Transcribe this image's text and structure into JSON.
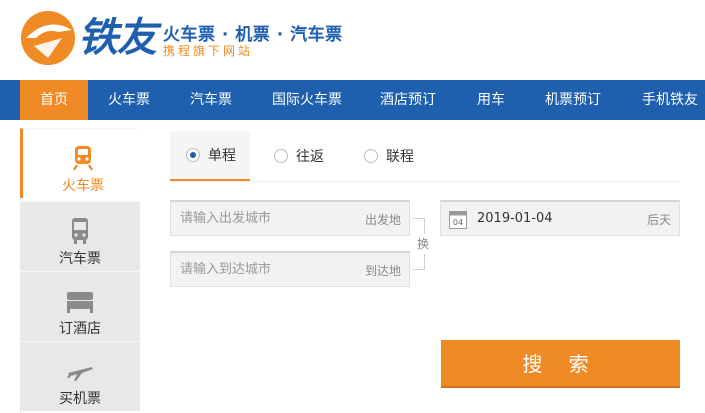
{
  "brand": {
    "name": "铁友",
    "slogan_main": "火车票 · 机票 · 汽车票",
    "slogan_sub": "携程旗下网站",
    "primary_color": "#1e5fae",
    "accent_color": "#f08a24"
  },
  "nav": {
    "items": [
      {
        "label": "首页",
        "active": true
      },
      {
        "label": "火车票"
      },
      {
        "label": "汽车票"
      },
      {
        "label": "国际火车票"
      },
      {
        "label": "酒店预订"
      },
      {
        "label": "用车"
      },
      {
        "label": "机票预订"
      },
      {
        "label": "手机铁友"
      }
    ]
  },
  "sidebar": {
    "items": [
      {
        "label": "火车票",
        "icon": "train-icon",
        "active": true
      },
      {
        "label": "汽车票",
        "icon": "bus-icon"
      },
      {
        "label": "订酒店",
        "icon": "bed-icon"
      },
      {
        "label": "买机票",
        "icon": "plane-icon"
      }
    ]
  },
  "trip_types": [
    {
      "label": "单程",
      "selected": true
    },
    {
      "label": "往返"
    },
    {
      "label": "联程"
    }
  ],
  "search": {
    "from_placeholder": "请输入出发城市",
    "from_tag": "出发地",
    "to_placeholder": "请输入到达城市",
    "to_tag": "到达地",
    "swap_label": "换",
    "date_value": "2019-01-04",
    "date_calendar_day": "04",
    "date_tag": "后天",
    "submit_label": "搜 索"
  }
}
